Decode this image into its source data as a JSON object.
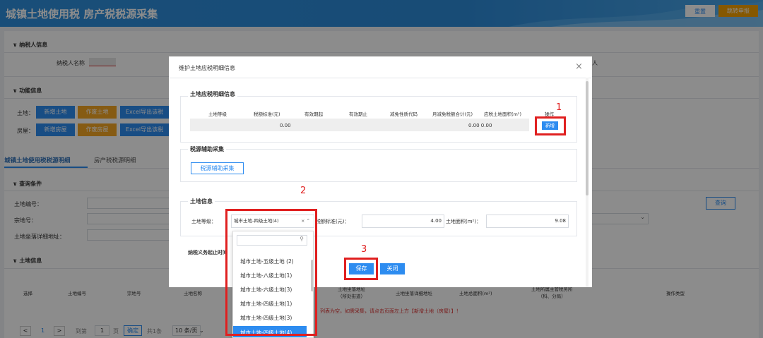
{
  "header": {
    "title": "城镇土地使用税 房产税税源采集",
    "btn_refresh": "重置",
    "btn_jump": "跳转申报"
  },
  "taxpayer": {
    "section_title": "纳税人信息",
    "name_label": "纳税人名称",
    "right_fragment": "人"
  },
  "functions": {
    "section_title": "功能信息",
    "land_label": "土地：",
    "house_label": "房屋：",
    "add_land": "新增土地",
    "void_land": "作废土地",
    "excel_land": "Excel导出该税",
    "add_house": "新增房屋",
    "void_house": "作废房屋",
    "excel_house": "Excel导出该税"
  },
  "tabs": [
    "城镇土地使用税税源明细",
    "房产税税源明细"
  ],
  "query": {
    "section_title": "查询条件",
    "land_no_label": "土地编号：",
    "parcel_no_label": "宗地号：",
    "address_label": "土地坐落详细地址：",
    "query_button": "查询"
  },
  "land_info": {
    "section_title": "土地信息",
    "columns": [
      "选择",
      "土地编号",
      "宗地号",
      "土地名称",
      "土地坐落地址\n（所处街道）",
      "土地坐落详细地址",
      "土地总面积(m²)",
      "土地所属主管税务所\n（科、分局）",
      "操作类型"
    ],
    "notice": "列表为空，如需采集，请点击页面左上方【新增土地（房屋）】！"
  },
  "pagination": {
    "current": "1",
    "goto_label": "到第",
    "goto_value": "1",
    "page_unit": "页",
    "confirm": "确定",
    "total": "共1条",
    "page_size": "10 条/页"
  },
  "dialog": {
    "title": "维护土地应税明细信息",
    "close": "×",
    "detail": {
      "section_title": "土地应税明细信息",
      "columns": [
        "土地等级",
        "税额标准(元)",
        "有效期起",
        "有效期止",
        "减免性质代码",
        "月减免税额合计(元)",
        "应税土地面积(m²)",
        "操作"
      ],
      "row": {
        "tax_std": "0.00",
        "monthly": "0.00 0.00"
      },
      "add_button": "新增"
    },
    "aux": {
      "section_title": "税源辅助采集",
      "button": "税源辅助采集"
    },
    "land": {
      "section_title": "土地信息",
      "grade_label": "土地等级：",
      "grade_value": "城市土地-四级土地(4)",
      "std_label": "税额标准(元)：",
      "std_value": "4.00",
      "area_label": "土地面积(m²)：",
      "area_value": "9.08",
      "cut_text": "纳税义务起止时间"
    },
    "save": "保存",
    "close_btn": "关闭"
  },
  "dropdown": {
    "partial": "...",
    "items": [
      "城市土地-五级土地 (2)",
      "城市土地-八级土地(1)",
      "城市土地-六级土地(3)",
      "城市土地-四级土地(1)",
      "城市土地-四级土地(3)",
      "城市土地-四级土地(4)"
    ]
  },
  "annotations": {
    "n1": "1",
    "n2": "2",
    "n3": "3"
  },
  "colors": {
    "header": "#2f8fdc",
    "primary": "#2d8cf0",
    "orange": "#f5a623",
    "annotation": "#e02020"
  }
}
